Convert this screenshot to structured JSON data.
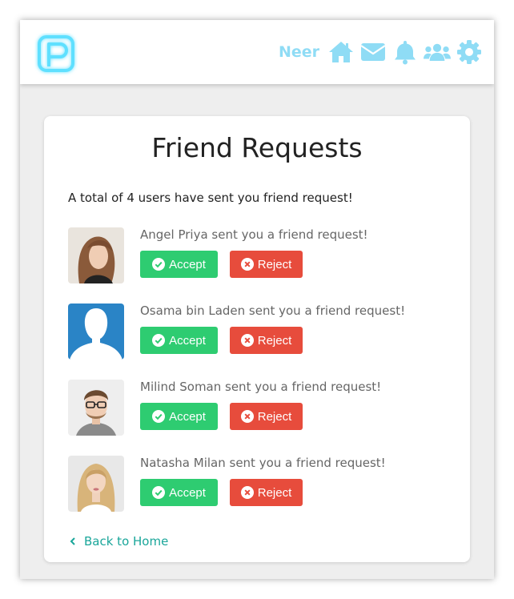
{
  "header": {
    "logo_letter": "P",
    "username": "Neer",
    "icons": [
      "home-icon",
      "envelope-icon",
      "bell-icon",
      "users-icon",
      "gear-icon"
    ],
    "accent_color": "#8fdcf5"
  },
  "main": {
    "title": "Friend Requests",
    "summary": "A total of 4 users have sent you friend request!",
    "accept_label": "Accept",
    "reject_label": "Reject",
    "requests": [
      {
        "text": "Angel Priya sent you a friend request!"
      },
      {
        "text": "Osama bin Laden sent you a friend request!"
      },
      {
        "text": "Milind Soman sent you a friend request!"
      },
      {
        "text": "Natasha Milan sent you a friend request!"
      }
    ],
    "back_label": "Back to Home"
  },
  "colors": {
    "accept": "#2ecc71",
    "reject": "#e74c3c",
    "link": "#1aa69a"
  }
}
